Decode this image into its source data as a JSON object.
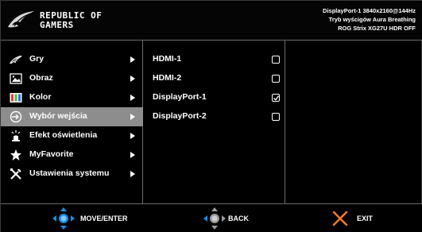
{
  "header": {
    "brand_line1": "REPUBLIC OF",
    "brand_line2": "GAMERS",
    "status_line1": "DisplayPort-1 3840x2160@144Hz",
    "status_line2": "Tryb wyścigów Aura Breathing",
    "status_line3": "ROG Strix XG27U HDR OFF"
  },
  "menu": {
    "items": [
      {
        "label": "Gry",
        "icon": "game-controller-icon"
      },
      {
        "label": "Obraz",
        "icon": "image-icon"
      },
      {
        "label": "Kolor",
        "icon": "color-bars-icon"
      },
      {
        "label": "Wybór wejścia",
        "icon": "input-icon",
        "active": true
      },
      {
        "label": "Efekt oświetlenia",
        "icon": "lightbulb-icon"
      },
      {
        "label": "MyFavorite",
        "icon": "star-icon"
      },
      {
        "label": "Ustawienia systemu",
        "icon": "tools-icon"
      }
    ]
  },
  "submenu": {
    "items": [
      {
        "label": "HDMI-1",
        "checked": false
      },
      {
        "label": "HDMI-2",
        "checked": false
      },
      {
        "label": "DisplayPort-1",
        "checked": true
      },
      {
        "label": "DisplayPort-2",
        "checked": false
      }
    ]
  },
  "footer": {
    "move_label": "MOVE/ENTER",
    "back_label": "BACK",
    "exit_label": "EXIT"
  },
  "colors": {
    "background": "#000000",
    "active_row": "#8d8d8d",
    "divider": "#6a6a6a",
    "joystick_blue": "#1f8be0",
    "exit_orange": "#f07a2a"
  }
}
